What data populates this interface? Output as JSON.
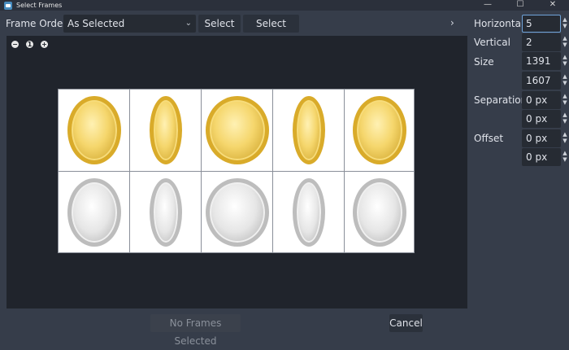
{
  "window": {
    "title": "Select Frames",
    "minimize_glyph": "—",
    "maximize_glyph": "☐",
    "close_glyph": "✕"
  },
  "toolbar": {
    "frame_order_label": "Frame Order",
    "frame_order_value": "As Selected",
    "dropdown_icon": "chevron-down-icon",
    "dropdown_glyph": "⌄",
    "select_all": "Select All",
    "select_none": "Select None",
    "collapse_glyph": "›"
  },
  "zoom": {
    "zoom_out": "−",
    "zoom_reset": "1",
    "zoom_in": "+"
  },
  "grid": {
    "columns": 5,
    "rows": 2
  },
  "settings": {
    "horizontal_label": "Horizontal",
    "horizontal_value": "5",
    "vertical_label": "Vertical",
    "vertical_value": "2",
    "size_label": "Size",
    "size_x": "1391 px",
    "size_y": "1607 px",
    "separation_label": "Separation",
    "separation_x": "0 px",
    "separation_y": "0 px",
    "offset_label": "Offset",
    "offset_x": "0 px",
    "offset_y": "0 px",
    "spin_up": "▲",
    "spin_down": "▼"
  },
  "footer": {
    "no_frames": "No Frames Selected",
    "cancel": "Cancel"
  },
  "colors": {
    "panel": "#363d4a",
    "preview": "#20242c",
    "field": "#262b33",
    "focus": "#6fa3d9",
    "gold": "#d9ab2a",
    "silver": "#bdbdbd"
  }
}
